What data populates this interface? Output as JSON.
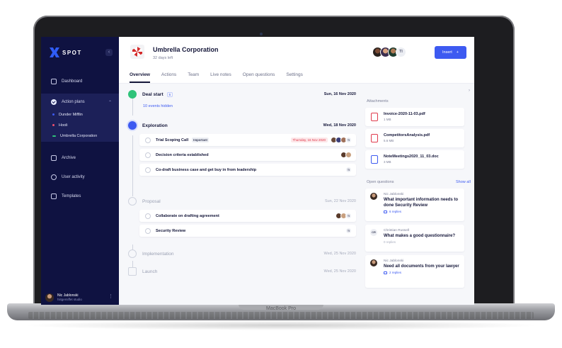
{
  "device": {
    "label": "MacBook Pro"
  },
  "sidebar": {
    "brand": "SPOT",
    "collapse_icon": "chevron-left-icon",
    "nav": [
      {
        "label": "Dashboard",
        "icon": "home-icon"
      },
      {
        "label": "Action plans",
        "icon": "check-circle-icon"
      },
      {
        "label": "Archive",
        "icon": "archive-icon"
      },
      {
        "label": "User activity",
        "icon": "user-icon"
      },
      {
        "label": "Templates",
        "icon": "templates-icon"
      }
    ],
    "plans": [
      {
        "label": "Dunder Mifflin",
        "color": "#3d5af1"
      },
      {
        "label": "Hooli",
        "color": "#f0506e"
      },
      {
        "label": "Umbrella Corporation",
        "color": "#2fc37a"
      }
    ],
    "user": {
      "name": "Nic Jablonski",
      "org": "hiitgemiffet studio"
    }
  },
  "header": {
    "company": "Umbrella Corporation",
    "days_left": "32 days left",
    "avatar_initials": "TI",
    "insert_label": "Insert",
    "insert_icon": "+",
    "tabs": [
      "Overview",
      "Actions",
      "Team",
      "Live notes",
      "Open questions",
      "Settings"
    ],
    "active_tab": "Overview"
  },
  "timeline": {
    "stages": [
      {
        "name": "Deal start",
        "date": "Sun, 16 Nov 2020",
        "status": "done",
        "count": "6"
      },
      {
        "name": "Exploration",
        "date": "Wed, 18 Nov 2020",
        "status": "active"
      },
      {
        "name": "Proposal",
        "date": "Sun, 22 Nov 2020",
        "status": "upcoming"
      },
      {
        "name": "Implementation",
        "date": "Wed, 25 Nov 2020",
        "status": "upcoming"
      },
      {
        "name": "Launch",
        "date": "Wed, 25 Nov 2020",
        "status": "upcoming"
      }
    ],
    "hidden_events": "10 events hidden",
    "exploration_tasks": [
      {
        "name": "Trial Scoping Call",
        "tag": "Important",
        "due": "Thursday, 16 Nov 2020",
        "initials": "TI"
      },
      {
        "name": "Decision criteria established",
        "tag": "",
        "due": "",
        "initials": ""
      },
      {
        "name": "Co-draft business case and get buy in from leadership",
        "tag": "",
        "due": "",
        "initials": "TI"
      }
    ],
    "proposal_tasks": [
      {
        "name": "Collaborate on drafting agreement",
        "initials": "TI"
      },
      {
        "name": "Security Review",
        "initials": "TI"
      }
    ]
  },
  "attachments": {
    "title": "Attachments",
    "files": [
      {
        "name": "Invoice-2020-11-03.pdf",
        "size": "1 MB",
        "type": "pdf",
        "color": "#e03b4d"
      },
      {
        "name": "CompetitorsAnalysis.pdf",
        "size": "5.6 MB",
        "type": "pdf",
        "color": "#e03b4d"
      },
      {
        "name": "NoteMeetings2020_11_03.doc",
        "size": "3 MB",
        "type": "doc",
        "color": "#3d5af1"
      }
    ]
  },
  "open_questions": {
    "title": "Open questions",
    "show_all": "Show all",
    "items": [
      {
        "author": "Nic Jablonski",
        "question": "What important information needs to done Security Review",
        "replies": "6 replies"
      },
      {
        "author": "Christian Russell",
        "initials": "CR",
        "question": "What makes a good questionnaire?",
        "replies": "0 replies"
      },
      {
        "author": "Nic Jablonski",
        "question": "Need all documents from your lawyer",
        "replies": "2 replies"
      }
    ]
  },
  "colors": {
    "sidebar": "#0f1241",
    "accent": "#3d5af1",
    "success": "#2fc37a",
    "danger": "#e03b4d"
  }
}
